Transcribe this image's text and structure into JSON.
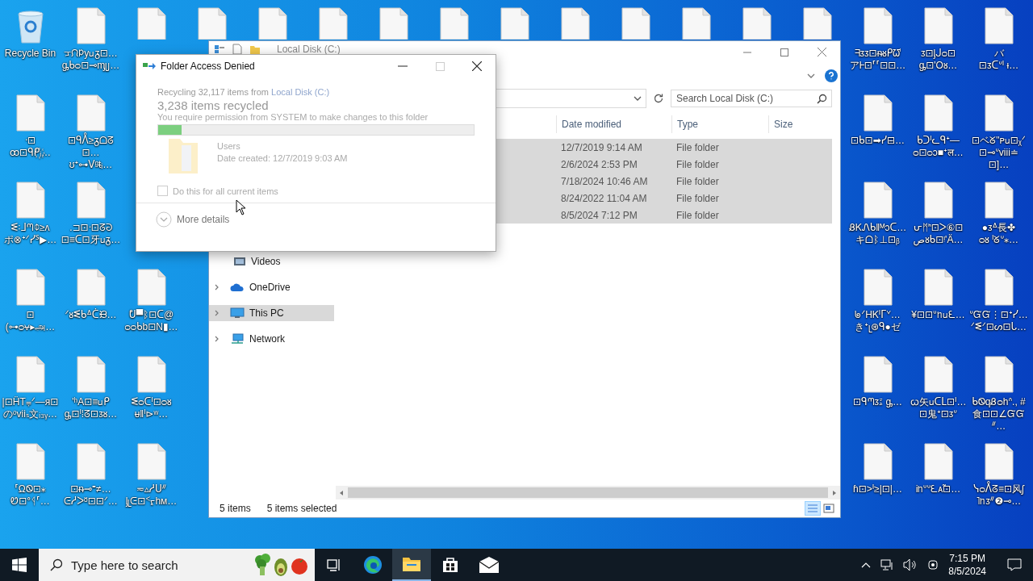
{
  "desktop": {
    "left_columns": [
      [
        {
          "kind": "recycle",
          "label": "Recycle Bin"
        },
        {
          "kind": "file",
          "label": "ᐧ⊡\nꝏ⊡ᑫᑭ꙰ᵢ…"
        },
        {
          "kind": "file",
          "label": "ᓬ꞉ᒧᘉᛰ≥ᴧ\nポ⊗ᐩᐟᓯᔆ▶…"
        },
        {
          "kind": "file",
          "label": "⊡\n(⊶ᴑ⩝▸அ…"
        },
        {
          "kind": "file",
          "label": "|⊡ḦT⩦ᐟ—ᴙ⊡\nのᵒvііₛ文ᵢ₃ᵧ…"
        },
        {
          "kind": "file",
          "label": "⸢ΩᏫ⊡⁎\nᏬ⊡ᐤᛩ⸢…"
        }
      ],
      [
        {
          "kind": "file",
          "label": "ᠴᙁᱞyᥙᵹ⊡…\nᶃᑲᴑ⊡⊸ᶆᥩ…"
        },
        {
          "kind": "file",
          "label": "⊡ᑫᐰ≥ᵹᗝᘔ⊡…\nʊᐩ⊶ᐯᶢᵵᵢ…"
        },
        {
          "kind": "file",
          "label": ".⊐⊡ᐧ⊡ᘔᘒ\n⊡≡ᑕ⊡牙ᥙᵹ…"
        },
        {
          "kind": "file",
          "label": "ᐟᴕᓬᑲᐞᑖᙝ…"
        },
        {
          "kind": "file",
          "label": "'ʰA⊡≡ᥙᑭ\nᶃ⊡ᑊ⁞ᘔ⊡ᴣᴕ…"
        },
        {
          "kind": "file",
          "label": "⊡ᵰ⊸ᙾ≠…\nᕮᓱᐳᴽ⊡⊡ᐟ…"
        }
      ],
      [
        {
          "kind": "file",
          "label": "ᕞ▀ᛒ⊡ᑕ@\nᴑᴑᑲb⊡N▮…"
        },
        {
          "kind": "file",
          "label": "ᓬᴑᑕᑊ⊡ᴑᴕ\nᵾ‖ᑊ⊳ʷ…"
        },
        {
          "kind": "file",
          "label": "≂▵ᓱᑌᐥ\nᶅᥨᕮ⊡ᑉᠷhᴍ…"
        }
      ]
    ],
    "right_columns": [
      [
        {
          "kind": "file",
          "label": "ᖷᴣᴣ⊡ᵰᴕᑭᘺ\nアᎰ⊡⸢⸢⊡⊡…"
        },
        {
          "kind": "file",
          "label": "⊡ᑲ⊡➡ᓯ⊟…"
        },
        {
          "kind": "file",
          "label": "ᏰᏦᏁᑲ‖ᴹᴐᑕ…\nキᗝᛒ⊥⊡ᵦ"
        },
        {
          "kind": "file",
          "label": "ᖚᐟHᏦᑊᒥᘁ…\nきᐩᥨ⊛ᑫ●ゼ"
        },
        {
          "kind": "file",
          "label": "⊡ᑫᘉᴣ፤ ᶃ…"
        },
        {
          "kind": "file",
          "label": "ɦ⊡>ᑊ≥|⊡|…"
        }
      ],
      [
        {
          "kind": "file",
          "label": "ᴣ⊡ᶅᒍᴑ⊡\nᶃ⊡'Oᴕ…"
        },
        {
          "kind": "file",
          "label": "ᑲᑐᑊᓚᑫᐩ—\nᴑ⊡ᴑᴐ■ᐩल…"
        },
        {
          "kind": "file",
          "label": "ᕂᛗᑋ⊡ᐳ⑥⊡\nصᴕᑲ⊡ᵎ'Ä…"
        },
        {
          "kind": "file",
          "label": "¥⊡⊡ᐡᥒᥙᘍ…"
        },
        {
          "kind": "file",
          "label": "ꞷ矢ᥙᑕᒪ⊡ᑊ…\n⊡鬼ᐩ⊡ᴣᐡ"
        },
        {
          "kind": "file",
          "label": "Ꭵᥒᐡᐡᘍᴀ̃⊡…"
        }
      ],
      [
        {
          "kind": "file",
          "label": "バ\n⊡ᴣᑕᐡᑊ ᵻ…"
        },
        {
          "kind": "file",
          "label": "⊡ベᘜ\"ᴩᥙ⊡ᵪᐟ\n⊡⊸ᐡviii≐⊡]…"
        },
        {
          "kind": "file",
          "label": "●ᴣᐞ長✤\nᴑᴕ ᑊᘜᐡ⁎…"
        },
        {
          "kind": "file",
          "label": "ᐡᏳᏳ⋮⊡ᐩᓯ…\nᐟᓬᐟ⊡ᔕ⊡ᒐ…"
        },
        {
          "kind": "file",
          "label": "ᑲᏫqᏰᴑhᐢ., #\n食⊡⊡∠ᏳᏳᐥ…"
        },
        {
          "kind": "file",
          "label": "ᓭᴑᐰᘔ≡⊡风ʃ\n˥ᥒᴣᐥ❷⊸…"
        }
      ]
    ]
  },
  "explorer": {
    "title": "Local Disk (C:)",
    "search": {
      "placeholder": "Search Local Disk (C:)"
    },
    "columns": [
      "Date modified",
      "Type",
      "Size"
    ],
    "rows": [
      {
        "date": "12/7/2019 9:14 AM",
        "type": "File folder",
        "selected": true
      },
      {
        "date": "2/6/2024 2:53 PM",
        "type": "File folder",
        "selected": true
      },
      {
        "date": "7/18/2024 10:46 AM",
        "type": "File folder",
        "selected": true
      },
      {
        "date": "8/24/2022 11:04 AM",
        "type": "File folder",
        "selected": true
      },
      {
        "date": "8/5/2024 7:12 PM",
        "type": "File folder",
        "selected": true
      }
    ],
    "nav": [
      {
        "kind": "videos",
        "label": "Videos",
        "selected": false
      },
      {
        "kind": "cloud",
        "label": "OneDrive",
        "selected": false
      },
      {
        "kind": "pc",
        "label": "This PC",
        "selected": true
      },
      {
        "kind": "network",
        "label": "Network",
        "selected": false
      }
    ],
    "status": {
      "count": "5 items",
      "selection": "5 items selected"
    }
  },
  "dialog": {
    "title": "Folder Access Denied",
    "progress_text": "Recycling 32,117 items from",
    "progress_link": "Local Disk (C:)",
    "headline": "3,238 items recycled",
    "message": "You require permission from SYSTEM to make changes to this folder",
    "level": 0.075,
    "item_name": "Users",
    "item_date": "Date created: 12/7/2019 9:03 AM",
    "checkbox": {
      "label": "Do this for all current items",
      "checked": false
    },
    "more": "More details"
  },
  "taskbar": {
    "search": {
      "placeholder": "Type here to search"
    },
    "time": "7:15 PM",
    "date": "8/5/2024"
  }
}
